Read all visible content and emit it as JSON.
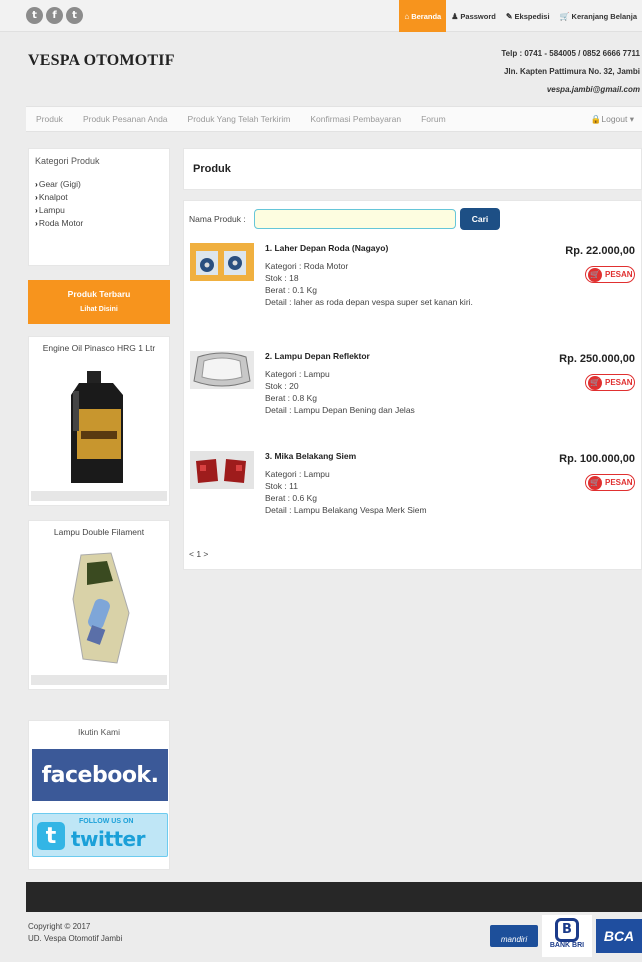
{
  "topbar": {
    "social": [
      {
        "icon": "twitter-icon",
        "glyph": "t"
      },
      {
        "icon": "facebook-icon",
        "glyph": "f"
      },
      {
        "icon": "tumblr-icon",
        "glyph": "t"
      }
    ],
    "nav": [
      {
        "label": "Beranda",
        "glyph": "⌂",
        "icon": "home-icon",
        "active": true
      },
      {
        "label": "Password",
        "glyph": "♟",
        "icon": "user-icon",
        "active": false
      },
      {
        "label": "Ekspedisi",
        "glyph": "✎",
        "icon": "edit-icon",
        "active": false
      },
      {
        "label": "Keranjang Belanja",
        "glyph": "🛒",
        "icon": "cart-icon",
        "active": false
      }
    ]
  },
  "header": {
    "brand": "VESPA OTOMOTIF",
    "phone": "Telp : 0741 - 584005 / 0852 6666 7711",
    "address": "Jln. Kapten Pattimura No. 32, Jambi",
    "email": "vespa.jambi@gmail.com"
  },
  "mainnav": {
    "items": [
      "Produk",
      "Produk Pesanan Anda",
      "Produk Yang Telah Terkirim",
      "Konfirmasi Pembayaran",
      "Forum"
    ],
    "logout": "Logout"
  },
  "sidebar": {
    "category_title": "Kategori Produk",
    "categories": [
      "Gear (Gigi)",
      "Knalpot",
      "Lampu",
      "Roda Motor"
    ],
    "newest_title": "Produk Terbaru",
    "newest_link": "Lihat Disini",
    "featured": [
      {
        "name": "Engine Oil Pinasco HRG 1 Ltr"
      },
      {
        "name": "Lampu Double Filament"
      }
    ],
    "follow_title": "Ikutin Kami",
    "facebook_label": "facebook.",
    "twitter_follow": "FOLLOW US ON",
    "twitter_label": "twitter"
  },
  "content": {
    "title": "Produk",
    "search_label": "Nama Produk :",
    "search_value": "",
    "search_button": "Cari",
    "pesan_label": "PESAN",
    "products": [
      {
        "name": "1. Laher Depan Roda (Nagayo)",
        "kategori": "Kategori : Roda Motor",
        "stok": "Stok : 18",
        "berat": "Berat : 0.1 Kg",
        "detail": "Detail : laher as roda depan vespa super set kanan kiri.",
        "price": "Rp. 22.000,00"
      },
      {
        "name": "2. Lampu Depan Reflektor",
        "kategori": "Kategori : Lampu",
        "stok": "Stok : 20",
        "berat": "Berat : 0.8 Kg",
        "detail": "Detail : Lampu Depan Bening dan Jelas",
        "price": "Rp. 250.000,00"
      },
      {
        "name": "3. Mika Belakang Siem",
        "kategori": "Kategori : Lampu",
        "stok": "Stok : 11",
        "berat": "Berat : 0.6 Kg",
        "detail": "Detail : Lampu Belakang Vespa Merk Siem",
        "price": "Rp. 100.000,00"
      }
    ],
    "pager": "< 1 >"
  },
  "footer": {
    "copyright": "Copyright © 2017",
    "company": "UD. Vespa Otomotif Jambi",
    "banks": [
      "mandiri",
      "BANK BRI",
      "BCA"
    ]
  }
}
